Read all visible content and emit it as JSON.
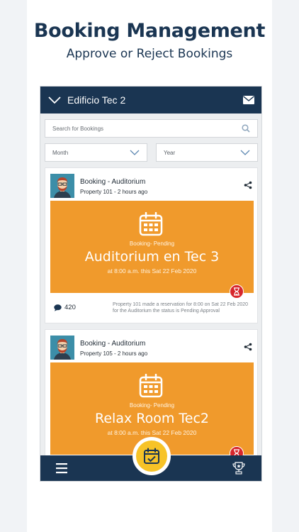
{
  "promo": {
    "headline": "Booking Management",
    "subline": "Approve or Reject Bookings"
  },
  "topbar": {
    "title": "Edificio Tec 2",
    "left_icon": "chevron-down-icon",
    "right_icon": "mail-icon"
  },
  "search": {
    "placeholder": "Search for Bookings",
    "icon": "search-icon"
  },
  "filters": {
    "month_label": "Month",
    "year_label": "Year"
  },
  "cards": [
    {
      "title": "Booking - Auditorium",
      "subtitle": "Property 101 - 2 hours ago",
      "status": "Booking- Pending",
      "place": "Auditorium en Tec 3",
      "when": "at 8:00 a.m. this Sat 22 Feb 2020",
      "comment_count": "420",
      "description": "Property 101 made a reservation for 8:00 on Sat 22 Feb 2020 for the Auditorium the status is Pending Approval"
    },
    {
      "title": "Booking - Auditorium",
      "subtitle": "Property 105 - 2 hours ago",
      "status": "Booking- Pending",
      "place": "Relax Room Tec2",
      "when": "at 8:00 a.m. this Sat 22 Feb 2020"
    }
  ],
  "bottombar": {
    "left_icon": "menu-icon",
    "center_icon": "calendar-check-icon",
    "right_icon": "trophy-icon"
  },
  "colors": {
    "navy": "#1a3552",
    "orange": "#f09a2c",
    "yellow": "#f7c327",
    "red": "#d7262c"
  }
}
